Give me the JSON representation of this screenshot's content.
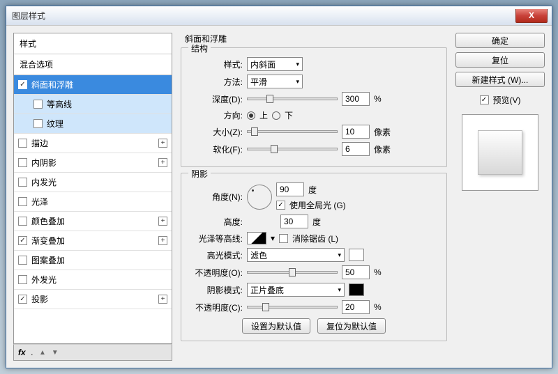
{
  "title": "图层样式",
  "close": "X",
  "left": {
    "styles_header": "样式",
    "blend_header": "混合选项",
    "items": [
      {
        "label": "斜面和浮雕",
        "checked": true,
        "selected": true,
        "expandable": false
      },
      {
        "label": "等高线",
        "checked": false,
        "sub": true
      },
      {
        "label": "纹理",
        "checked": false,
        "sub": true
      },
      {
        "label": "描边",
        "checked": false,
        "plus": true
      },
      {
        "label": "内阴影",
        "checked": false,
        "plus": true
      },
      {
        "label": "内发光",
        "checked": false
      },
      {
        "label": "光泽",
        "checked": false
      },
      {
        "label": "颜色叠加",
        "checked": false,
        "plus": true
      },
      {
        "label": "渐变叠加",
        "checked": true,
        "plus": true
      },
      {
        "label": "图案叠加",
        "checked": false
      },
      {
        "label": "外发光",
        "checked": false
      },
      {
        "label": "投影",
        "checked": true,
        "plus": true
      }
    ],
    "fx": "fx"
  },
  "center": {
    "title": "斜面和浮雕",
    "structure": {
      "legend": "结构",
      "style_label": "样式:",
      "style_value": "内斜面",
      "method_label": "方法:",
      "method_value": "平滑",
      "depth_label": "深度(D):",
      "depth_value": "300",
      "depth_unit": "%",
      "direction_label": "方向:",
      "up": "上",
      "down": "下",
      "size_label": "大小(Z):",
      "size_value": "10",
      "size_unit": "像素",
      "soften_label": "软化(F):",
      "soften_value": "6",
      "soften_unit": "像素"
    },
    "shadow": {
      "legend": "阴影",
      "angle_label": "角度(N):",
      "angle_value": "90",
      "angle_unit": "度",
      "global_light": "使用全局光 (G)",
      "altitude_label": "高度:",
      "altitude_value": "30",
      "altitude_unit": "度",
      "gloss_label": "光泽等高线:",
      "antialias": "消除锯齿 (L)",
      "highlight_mode_label": "高光模式:",
      "highlight_mode_value": "滤色",
      "hl_opacity_label": "不透明度(O):",
      "hl_opacity_value": "50",
      "pct": "%",
      "shadow_mode_label": "阴影模式:",
      "shadow_mode_value": "正片叠底",
      "sh_opacity_label": "不透明度(C):",
      "sh_opacity_value": "20"
    },
    "set_default": "设置为默认值",
    "reset_default": "复位为默认值"
  },
  "right": {
    "ok": "确定",
    "reset": "复位",
    "new_style": "新建样式 (W)...",
    "preview": "预览(V)"
  }
}
